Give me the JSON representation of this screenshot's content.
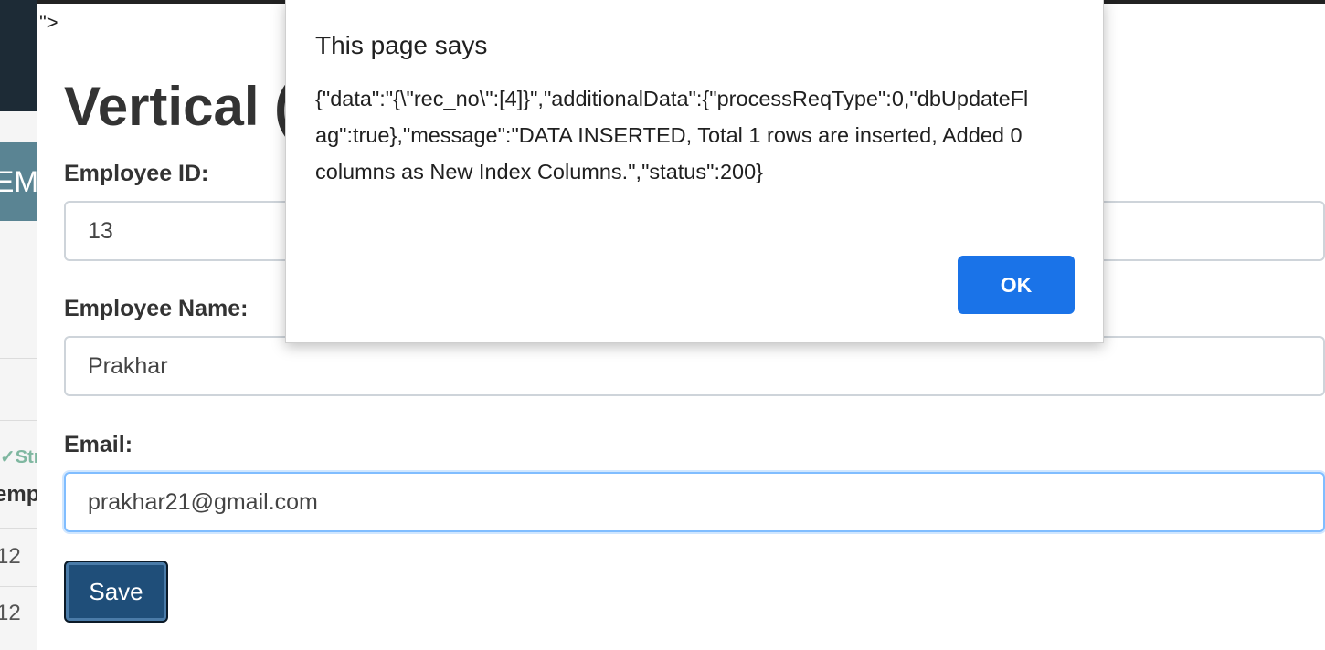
{
  "background_app": {
    "tile_text": "EM",
    "section_label": "Str",
    "column_header": "emp",
    "rows": [
      "12",
      "12"
    ]
  },
  "stray_text": "\">",
  "form": {
    "title": "Vertical (",
    "fields": [
      {
        "label": "Employee ID:",
        "value": "13"
      },
      {
        "label": "Employee Name:",
        "value": "Prakhar"
      },
      {
        "label": "Email:",
        "value": "prakhar21@gmail.com"
      }
    ],
    "save_label": "Save"
  },
  "alert": {
    "title": "This page says",
    "message": "{\"data\":\"{\\\"rec_no\\\":[4]}\",\"additionalData\":{\"processReqType\":0,\"dbUpdateFlag\":true},\"message\":\"DATA INSERTED, Total 1 rows are inserted, Added 0 columns as New Index Columns.\",\"status\":200}",
    "ok_label": "OK"
  },
  "colors": {
    "primary": "#1a73e8",
    "save_button": "#1f4e79",
    "navbar": "#1d2b36"
  }
}
